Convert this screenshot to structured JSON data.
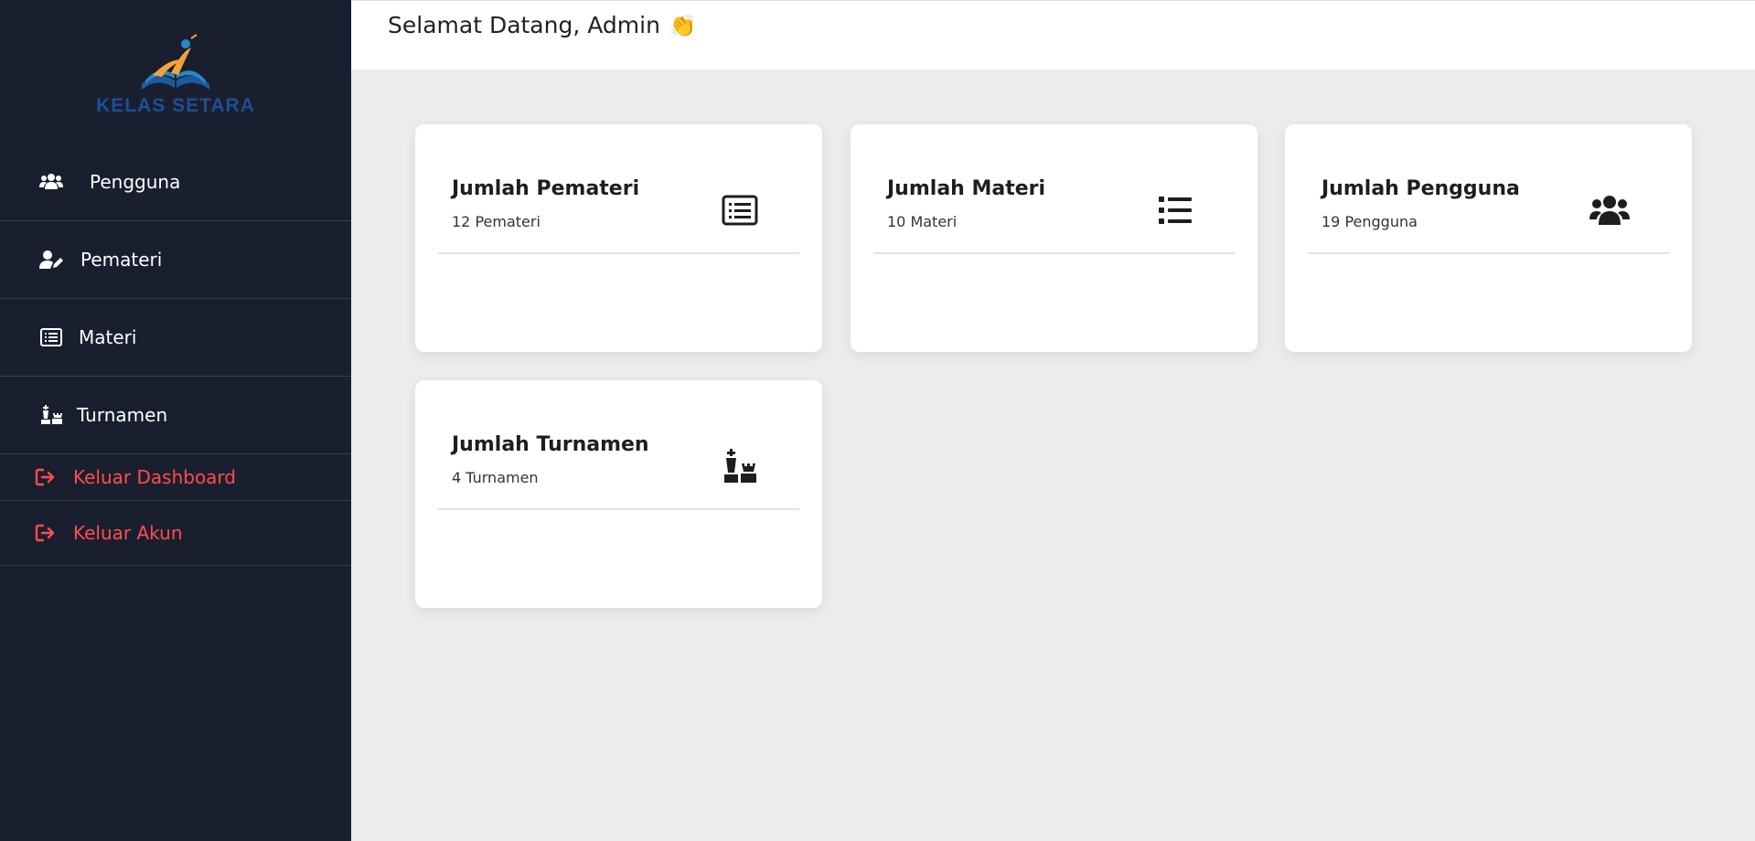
{
  "sidebar": {
    "brand": "KELAS SETARA",
    "items": [
      {
        "label": "Pengguna",
        "icon": "users-icon"
      },
      {
        "label": "Pemateri",
        "icon": "user-edit-icon"
      },
      {
        "label": "Materi",
        "icon": "list-alt-icon"
      },
      {
        "label": "Turnamen",
        "icon": "chess-icon"
      },
      {
        "label": "Keluar Dashboard",
        "icon": "sign-out-icon"
      },
      {
        "label": "Keluar Akun",
        "icon": "sign-out-icon"
      }
    ]
  },
  "header": {
    "welcome": "Selamat Datang, Admin",
    "emoji": "👏"
  },
  "cards": [
    {
      "title": "Jumlah Pemateri",
      "subtitle": "12 Pemateri",
      "icon": "list-alt-icon"
    },
    {
      "title": "Jumlah Materi",
      "subtitle": "10 Materi",
      "icon": "list-icon"
    },
    {
      "title": "Jumlah Pengguna",
      "subtitle": "19 Pengguna",
      "icon": "users-icon"
    },
    {
      "title": "Jumlah Turnamen",
      "subtitle": "4 Turnamen",
      "icon": "chess-icon"
    }
  ],
  "colors": {
    "sidebar_bg": "#1a1f2f",
    "exit_text": "#ff4d4d",
    "brand_blue": "#1d4f96",
    "page_bg": "#ececec"
  }
}
